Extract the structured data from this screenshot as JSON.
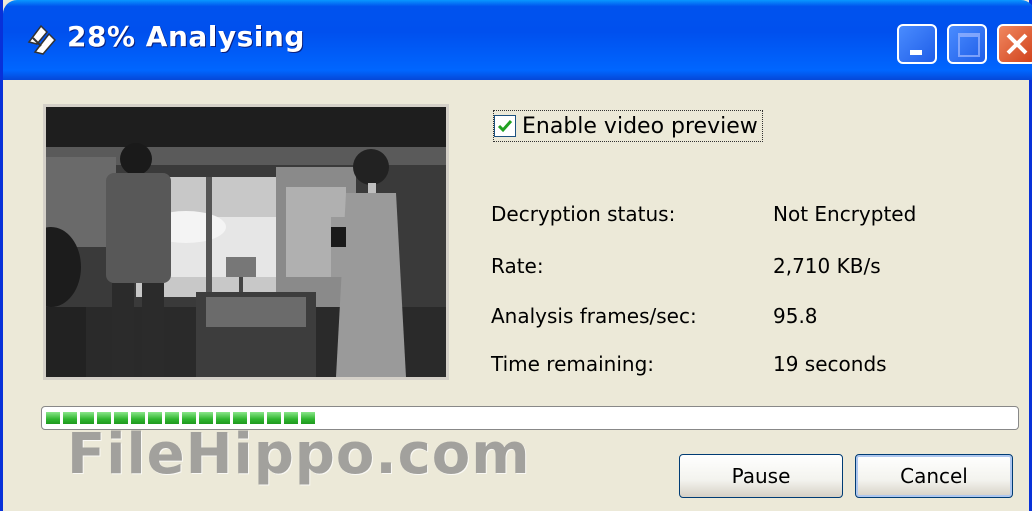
{
  "window": {
    "title": "28% Analysing",
    "icon": "analysis-tool-icon"
  },
  "preview": {
    "image": "video-frame-preview"
  },
  "enable_preview": {
    "label": "Enable video preview",
    "checked": true
  },
  "info": [
    {
      "label": "Decryption status:",
      "value": "Not Encrypted"
    },
    {
      "label": "Rate:",
      "value": "2,710 KB/s"
    },
    {
      "label": "Analysis frames/sec:",
      "value": "95.8"
    },
    {
      "label": "Time remaining:",
      "value": "19 seconds"
    }
  ],
  "progress": {
    "percent": 28,
    "color": "#2fb52f"
  },
  "buttons": {
    "pause": "Pause",
    "cancel": "Cancel"
  },
  "watermark": "FileHippo.com"
}
